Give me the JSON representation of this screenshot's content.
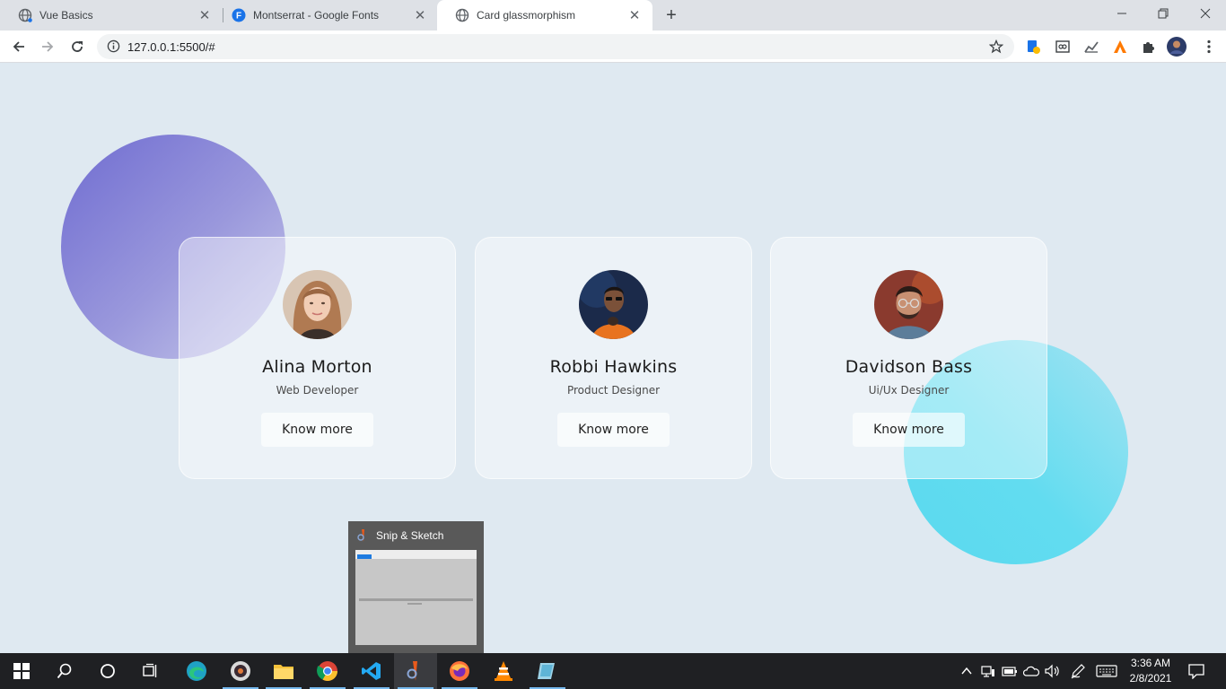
{
  "browser": {
    "tabs": [
      {
        "title": "Vue Basics",
        "icon": "globe-icon",
        "active": false
      },
      {
        "title": "Montserrat - Google Fonts",
        "icon": "google-fonts-icon",
        "active": false
      },
      {
        "title": "Card glassmorphism",
        "icon": "globe-icon",
        "active": true
      }
    ],
    "url": "127.0.0.1:5500/#",
    "new_tab_label": "+"
  },
  "cards": [
    {
      "name": "Alina Morton",
      "role": "Web Developer",
      "button": "Know more",
      "avatar": "woman-portrait"
    },
    {
      "name": "Robbi Hawkins",
      "role": "Product Designer",
      "button": "Know more",
      "avatar": "man-orange-shirt-portrait"
    },
    {
      "name": "Davidson Bass",
      "role": "Ui/Ux Designer",
      "button": "Know more",
      "avatar": "man-glasses-portrait"
    }
  ],
  "thumbnail": {
    "title": "Snip & Sketch"
  },
  "taskbar": {
    "apps": [
      "start-icon",
      "search-icon",
      "cortana-icon",
      "task-view-icon",
      "edge-icon",
      "media-icon",
      "file-explorer-icon",
      "chrome-icon",
      "vscode-icon",
      "snip-sketch-icon",
      "firefox-icon",
      "vlc-icon",
      "app-icon"
    ],
    "time": "3:36 AM",
    "date": "2/8/2021"
  },
  "colors": {
    "page_bg": "#dfe9f1",
    "purple_blob": "#6f6cd1",
    "cyan_blob": "#5ad9ee",
    "taskbar_bg": "#1f2023"
  }
}
